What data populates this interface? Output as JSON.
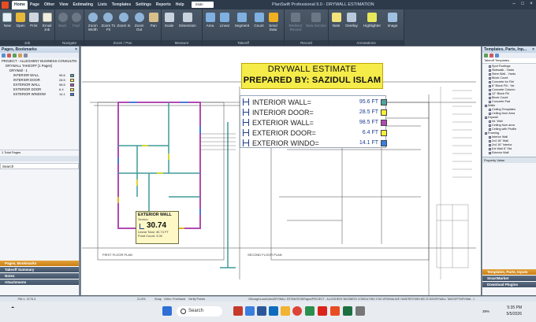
{
  "app": {
    "title": "PlanSwift Professional 9.0 - DRYWALL ESTIMATION"
  },
  "menu": {
    "items": [
      "Home",
      "Page",
      "Other",
      "View",
      "Estimating",
      "Lists",
      "Templates",
      "Settings",
      "Reports",
      "Help"
    ],
    "search_label": "Slide"
  },
  "ribbon": {
    "groups": [
      {
        "label": "Job",
        "buttons": [
          "New",
          "Open",
          "Print",
          "Email Job"
        ]
      },
      {
        "label": "Navigate",
        "buttons": [
          "Back",
          "Fwd"
        ]
      },
      {
        "label": "Zoom / Pan",
        "buttons": [
          "Zoom Width",
          "Zoom To Fit",
          "Zoom In",
          "Zoom Out",
          "Pan"
        ]
      },
      {
        "label": "Measure",
        "buttons": [
          "Scale",
          "Dimension"
        ]
      },
      {
        "label": "Takeoff",
        "buttons": [
          "Area",
          "Linear",
          "Segment",
          "Count",
          "Send Data"
        ]
      },
      {
        "label": "Record",
        "buttons": [
          "Redirect Record",
          "New Section"
        ]
      },
      {
        "label": "Annotations",
        "buttons": [
          "Note",
          "Overlay",
          "Highlighter",
          "Image"
        ]
      }
    ]
  },
  "left_panel": {
    "title": "Pages, Bookmarks",
    "tree": [
      {
        "label": "PROJECT - ALLEGHENY BUSINESS CONSULTIN",
        "indent": 0
      },
      {
        "label": "DRYWALL TAKEOFF [1 Pages]",
        "indent": 1
      },
      {
        "label": "DRYWall - 1",
        "indent": 2
      },
      {
        "label": "INTERIOR WALL",
        "indent": 3,
        "value": "95.6",
        "color": "#4fa3a0"
      },
      {
        "label": "INTERIOR DOOR",
        "indent": 3,
        "value": "28.5",
        "color": "#f4ee3a"
      },
      {
        "label": "EXTERIOR WALL",
        "indent": 3,
        "value": "98.5",
        "color": "#b04ab0"
      },
      {
        "label": "EXTERIOR DOOR",
        "indent": 3,
        "value": "6.4",
        "color": "#f4ee3a"
      },
      {
        "label": "EXTERIOR WINDOW",
        "indent": 3,
        "value": "14.1",
        "color": "#3a7ee0"
      }
    ],
    "pages_count": "1 Total Pages",
    "search_label": "Search",
    "tabs": [
      "Pages, Bookmarks",
      "Takeoff Summary",
      "Notes",
      "Attachments"
    ]
  },
  "estimate": {
    "title": "DRYWALL ESTIMATE",
    "prepared": "PREPARED BY: SAZIDUL ISLAM",
    "rows": [
      {
        "label": "INTERIOR WALL=",
        "amount": "95.6 FT",
        "color": "#4fa3a0"
      },
      {
        "label": "INTERIOR DOOR=",
        "amount": "28.5 FT",
        "color": "#f4ee3a"
      },
      {
        "label": "EXTERIOR WALL=",
        "amount": "98.5 FT",
        "color": "#b04ab0"
      },
      {
        "label": "EXTERIOR DOOR=",
        "amount": "6.4 FT",
        "color": "#f4ee3a"
      },
      {
        "label": "EXTERIOR WINDO=",
        "amount": "14.1 FT",
        "color": "#3a7ee0"
      }
    ]
  },
  "tooltip": {
    "title": "EXTERIOR WALL",
    "subtitle": "Section",
    "value": "30.74",
    "linear_total": "Linear Total: 30.74 FT",
    "point_count": "Point Count: 3.00"
  },
  "right_panel": {
    "title": "Templates, Parts, Inp...",
    "subtitle": "Takeoff Templates",
    "items": [
      "Spot Footings",
      "Sidewalk - Yards",
      "Stem Wall - Yards",
      "Block Count",
      "Concrete for Fiel",
      "8\" Block Fill - Yar",
      "Concrete Column",
      "12\" Block Fill",
      "Block Count",
      "Concrete Pad",
      "Walls",
      "Ceiling Templates",
      "Ceiling from Area",
      "Drywall",
      "Int. Wall",
      "Ceiling from area",
      "Ceiling with Profile",
      "Framing",
      "Interior Wall",
      "2x4 16\" Wall",
      "2x4 16\" Interior",
      "Ext Wall 6\" Std",
      "Exterior Wall"
    ],
    "property_label": "Property  Value",
    "tabs": [
      "Templates, Parts, Inputs",
      "SmartMarket",
      "Download Plugins"
    ]
  },
  "status": {
    "coords": "756.1, 2176.3",
    "zoom": "21.8%",
    "snap": "Snap",
    "ortho": "Ortho",
    "freehand": "Freehand",
    "verify": "Verify Points",
    "path": "\\\\Storage\\Local\\Jobs\\DRYWALL ESTIMATION\\Pages\\PROJECT - ALLEGHENY BUSINESS CONSULTING 1763 VIRGINIA AVE HAGERSTOWN MD 21740\\DRYWALL TAKEOFF\\DRYWall - 1"
  },
  "taskbar": {
    "search": "Search",
    "time": "5:35 PM",
    "date": "5/5/2026",
    "battery": "39%"
  },
  "drawing": {
    "plan_left": "FIRST FLOOR PLAN",
    "plan_right": "SECOND FLOOR PLAN"
  }
}
